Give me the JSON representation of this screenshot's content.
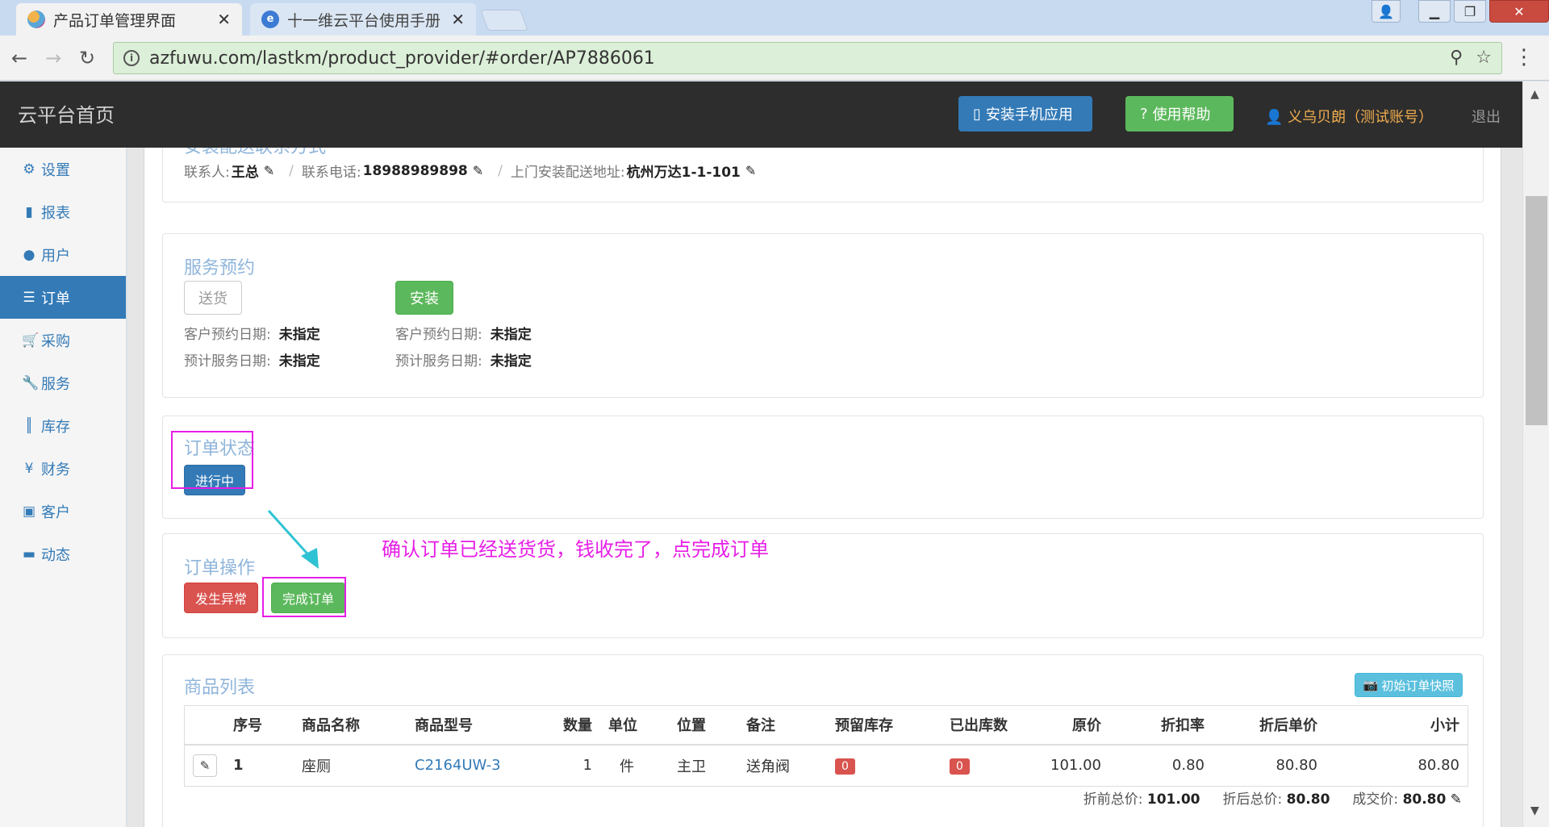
{
  "browser": {
    "tabs": [
      {
        "title": "产品订单管理界面",
        "active": true
      },
      {
        "title": "十一维云平台使用手册 -",
        "active": false
      }
    ],
    "url": "azfuwu.com/lastkm/product_provider/#order/AP7886061"
  },
  "header": {
    "brand": "云平台首页",
    "install_app": "安装手机应用",
    "help": "使用帮助",
    "user": "义乌贝朗（测试账号）",
    "logout": "退出"
  },
  "sidebar": {
    "items": [
      {
        "label": "设置",
        "icon": "gear-icon"
      },
      {
        "label": "报表",
        "icon": "bar-chart-icon"
      },
      {
        "label": "用户",
        "icon": "user-icon"
      },
      {
        "label": "订单",
        "icon": "list-icon",
        "active": true
      },
      {
        "label": "采购",
        "icon": "cart-icon"
      },
      {
        "label": "服务",
        "icon": "wrench-icon"
      },
      {
        "label": "库存",
        "icon": "barcode-icon"
      },
      {
        "label": "财务",
        "icon": "yen-icon"
      },
      {
        "label": "客户",
        "icon": "briefcase-icon"
      },
      {
        "label": "动态",
        "icon": "comment-icon"
      }
    ]
  },
  "contact": {
    "title": "安装配送联系方式",
    "person_label": "联系人:",
    "person": "王总",
    "phone_label": "联系电话:",
    "phone": "18988989898",
    "address_label": "上门安装配送地址:",
    "address": "杭州万达1-1-101"
  },
  "service": {
    "title": "服务预约",
    "delivery_btn": "送货",
    "install_btn": "安装",
    "cust_date_label": "客户预约日期:",
    "cust_date": "未指定",
    "est_date_label": "预计服务日期:",
    "est_date": "未指定"
  },
  "status": {
    "title": "订单状态",
    "value": "进行中"
  },
  "operations": {
    "title": "订单操作",
    "exception_btn": "发生异常",
    "complete_btn": "完成订单",
    "annotation": "确认订单已经送货货，钱收完了，点完成订单"
  },
  "goods": {
    "title": "商品列表",
    "snapshot_btn": "初始订单快照",
    "columns": [
      "序号",
      "商品名称",
      "商品型号",
      "数量",
      "单位",
      "位置",
      "备注",
      "预留库存",
      "已出库数",
      "原价",
      "折扣率",
      "折后单价",
      "小计"
    ],
    "rows": [
      {
        "no": "1",
        "name": "座厕",
        "model": "C2164UW-3",
        "qty": "1",
        "unit": "件",
        "location": "主卫",
        "remark": "送角阀",
        "reserved": "0",
        "shipped": "0",
        "price": "101.00",
        "discount": "0.80",
        "disc_price": "80.80",
        "subtotal": "80.80"
      }
    ],
    "total_before_label": "折前总价:",
    "total_before": "101.00",
    "total_after_label": "折后总价:",
    "total_after": "80.80",
    "deal_label": "成交价:",
    "deal": "80.80"
  },
  "colors": {
    "primary": "#337ab7",
    "success": "#5cb85c",
    "danger": "#d9534f",
    "annotation": "#e61ee6",
    "header_bg": "#2d2d2d"
  }
}
